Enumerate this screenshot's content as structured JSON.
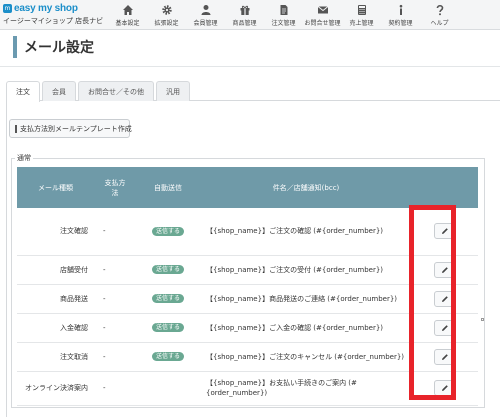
{
  "header": {
    "logo_mark": "m",
    "logo_brand": "easy my shop",
    "logo_sub": "イージーマイショップ 店長ナビ",
    "nav": [
      {
        "label": "基本設定",
        "icon": "home-icon"
      },
      {
        "label": "拡張設定",
        "icon": "gear-icon"
      },
      {
        "label": "会員管理",
        "icon": "user-icon"
      },
      {
        "label": "商品管理",
        "icon": "gift-icon"
      },
      {
        "label": "注文管理",
        "icon": "document-icon"
      },
      {
        "label": "お問合せ管理",
        "icon": "envelope-icon"
      },
      {
        "label": "売上管理",
        "icon": "calculator-icon"
      },
      {
        "label": "契約管理",
        "icon": "info-icon"
      },
      {
        "label": "ヘルプ",
        "icon": "question-icon"
      }
    ]
  },
  "page": {
    "title": "メール設定"
  },
  "tabs": [
    {
      "label": "注文",
      "active": true
    },
    {
      "label": "会員",
      "active": false
    },
    {
      "label": "お問合せ／その他",
      "active": false
    },
    {
      "label": "汎用",
      "active": false
    }
  ],
  "actions": {
    "create_template": "支払方法別メールテンプレート作成"
  },
  "section": {
    "legend": "通常"
  },
  "table": {
    "headers": [
      "メール種類",
      "支払方\n法",
      "自動送信",
      "件名／店舗通知(bcc)",
      ""
    ],
    "rows": [
      {
        "kind": "注文確認",
        "method": "-",
        "auto": "送信する",
        "subject": "【{shop_name}】ご注文の確認 (#{order_number})"
      },
      {
        "kind": "店舗受付",
        "method": "-",
        "auto": "送信する",
        "subject": "【{shop_name}】ご注文の受付 (#{order_number})"
      },
      {
        "kind": "商品発送",
        "method": "-",
        "auto": "送信する",
        "subject": "【{shop_name}】商品発送のご連絡 (#{order_number})"
      },
      {
        "kind": "入金確認",
        "method": "-",
        "auto": "送信する",
        "subject": "【{shop_name}】ご入金の確認 (#{order_number})"
      },
      {
        "kind": "注文取消",
        "method": "-",
        "auto": "送信する",
        "subject": "【{shop_name}】ご注文のキャンセル (#{order_number})"
      },
      {
        "kind": "オンライン決済案内",
        "method": "-",
        "auto": "",
        "subject": "【{shop_name}】お支払い手続きのご案内 (#{order_number})"
      }
    ]
  },
  "colors": {
    "header_bg": "#6f9aa8",
    "badge": "#6aa892",
    "highlight": "#e8232a",
    "brand": "#1b8ec9"
  }
}
